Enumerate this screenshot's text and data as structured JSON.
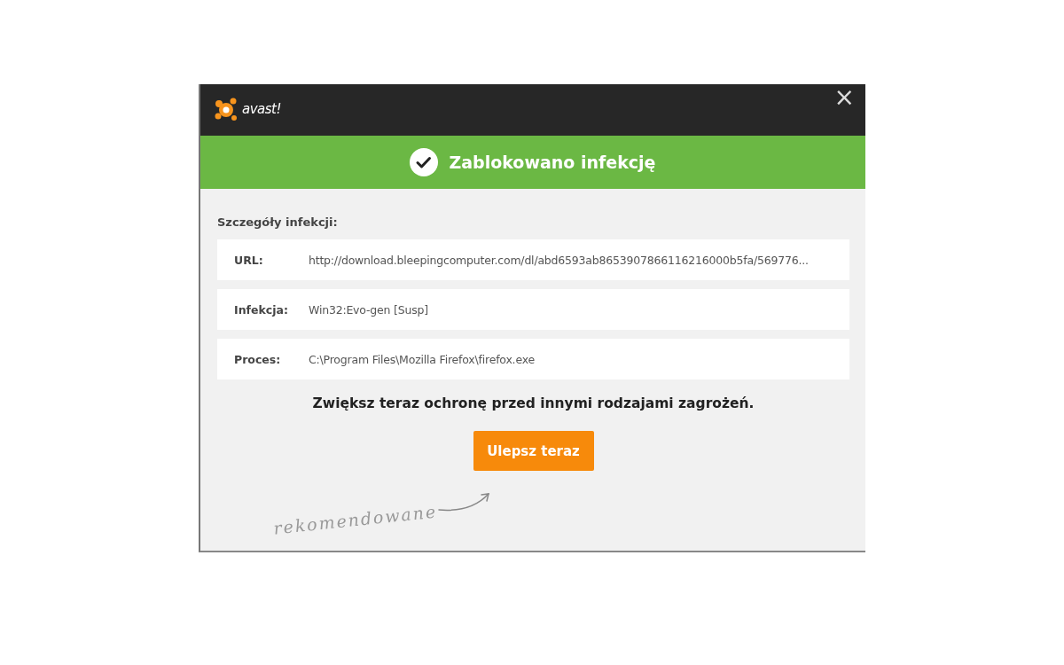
{
  "header": {
    "logo_text": "avast!",
    "close": "×"
  },
  "banner": {
    "title": "Zablokowano infekcję"
  },
  "details": {
    "heading": "Szczegóły infekcji:",
    "rows": [
      {
        "label": "URL:",
        "value": "http://download.bleepingcomputer.com/dl/abd6593ab8653907866116216000b5fa/569776..."
      },
      {
        "label": "Infekcja:",
        "value": "Win32:Evo-gen [Susp]"
      },
      {
        "label": "Proces:",
        "value": "C:\\Program Files\\Mozilla Firefox\\firefox.exe"
      }
    ]
  },
  "promo": {
    "text": "Zwiększ teraz ochronę przed innymi rodzajami zagrożeń.",
    "button": "Ulepsz teraz",
    "note": "rekomendowane"
  }
}
